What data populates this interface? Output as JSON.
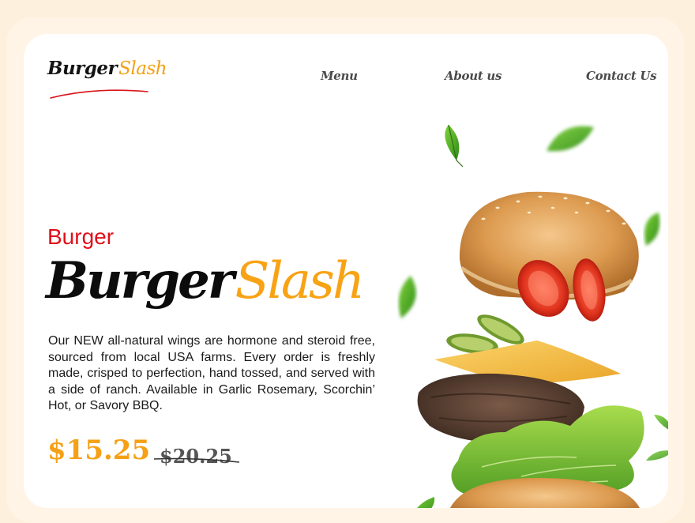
{
  "logo": {
    "part1": "Burger",
    "part2": "Slash"
  },
  "nav": {
    "menu": "Menu",
    "about": "About us",
    "contact": "Contact Us"
  },
  "hero": {
    "eyebrow": "Burger",
    "title_part1": "Burger",
    "title_part2": "Slash",
    "description": "Our NEW all-natural wings are hormone and steroid free, sourced from local USA farms. Every order is freshly made, crisped to perfection, hand tossed, and served with a side of ranch. Available in Garlic Rosemary, Scorchin’ Hot, or Savory BBQ.",
    "price": "$15.25",
    "old_price": "$20.25"
  },
  "colors": {
    "accent": "#f5a016",
    "red": "#e0101a",
    "background": "#fdf1de"
  }
}
